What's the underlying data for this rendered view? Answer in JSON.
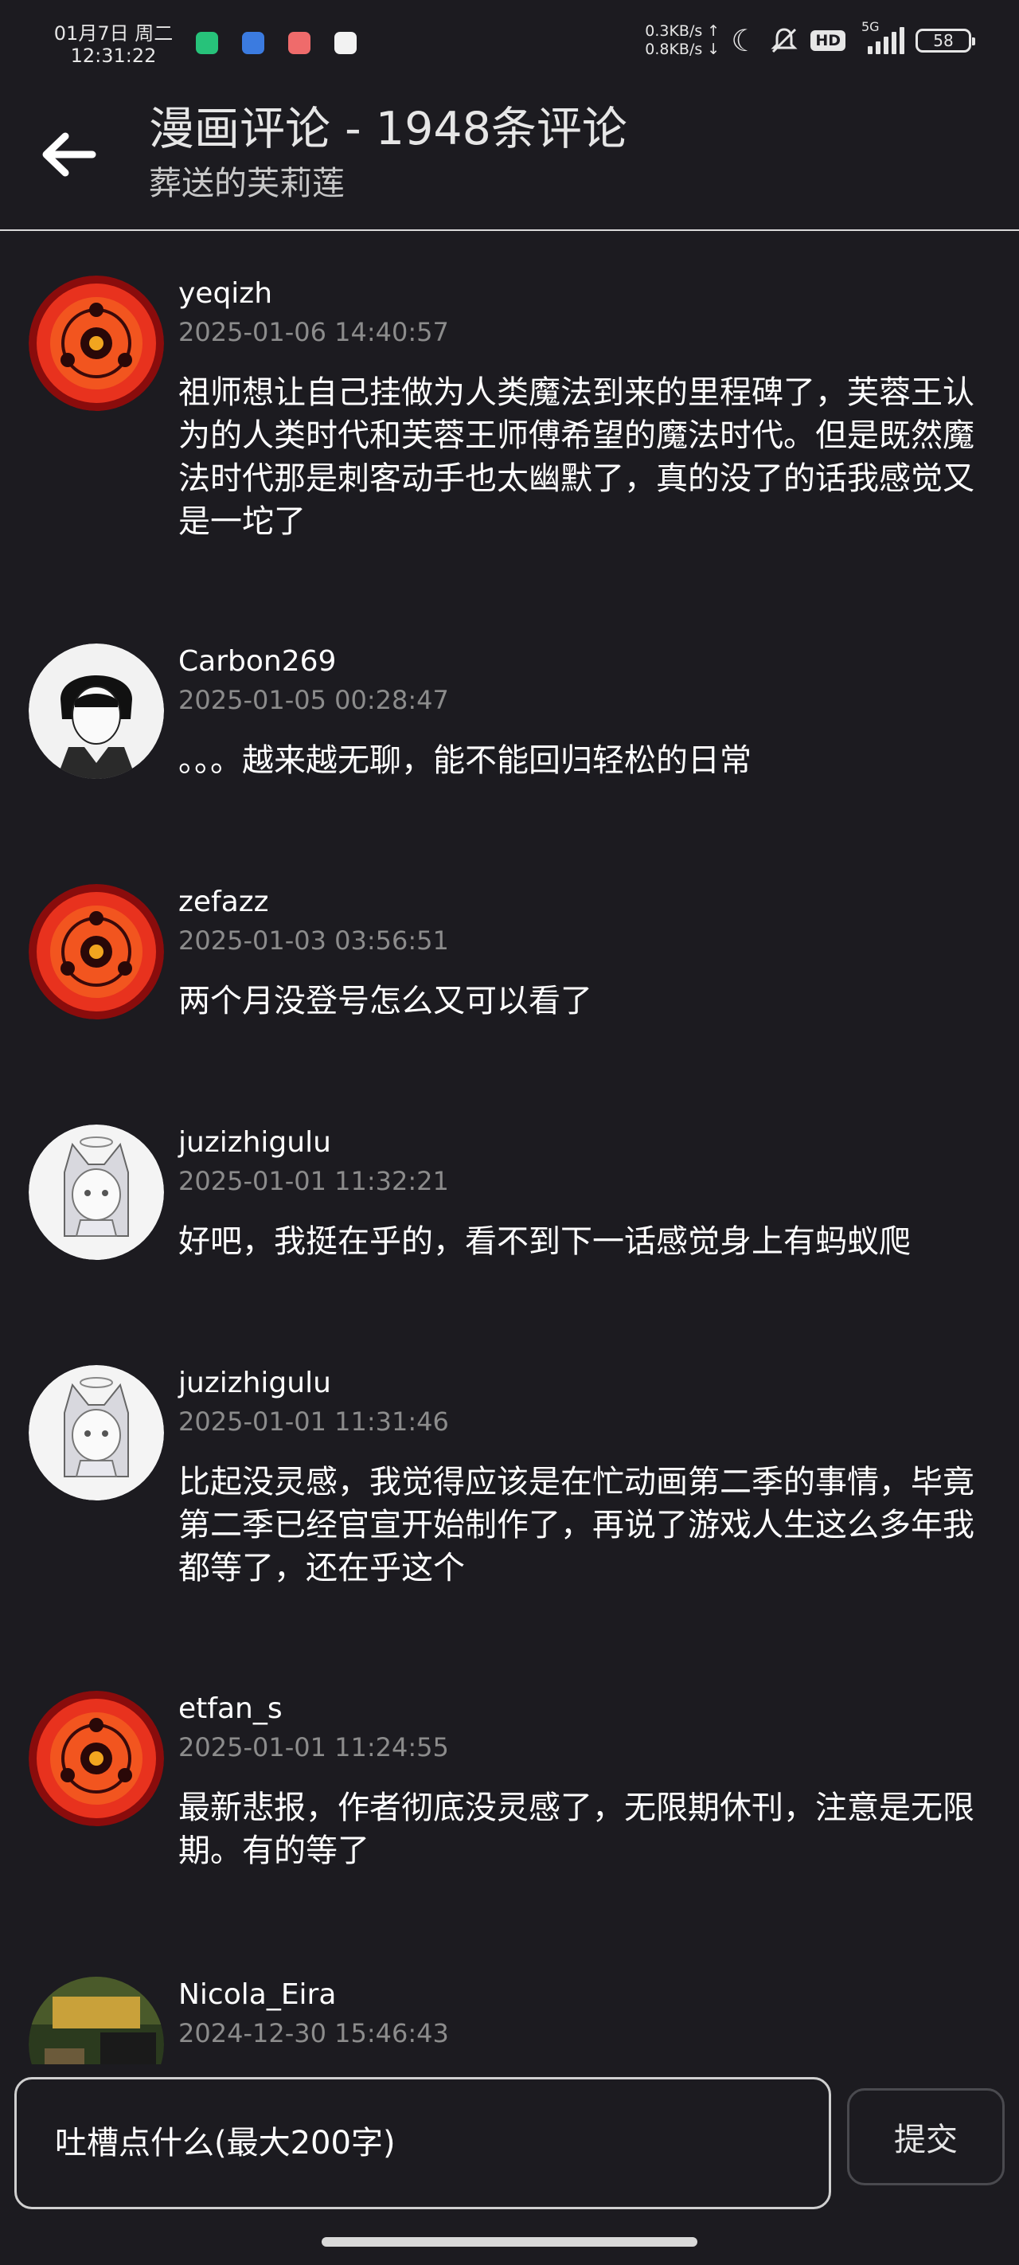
{
  "status_bar": {
    "date": "01月7日 周二",
    "time": "12:31:22",
    "up_speed": "0.3KB/s",
    "down_speed": "0.8KB/s",
    "network": "5G",
    "hd": "HD",
    "battery": "58",
    "app_icons": [
      "app-icon-green",
      "app-icon-blue",
      "app-icon-red",
      "app-icon-white"
    ]
  },
  "header": {
    "title": "漫画评论 - 1948条评论",
    "subtitle": "葬送的芙莉莲"
  },
  "comments": [
    {
      "username": "yeqizh",
      "time": "2025-01-06 14:40:57",
      "text": "祖师想让自己挂做为人类魔法到来的里程碑了，芙蓉王认为的人类时代和芙蓉王师傅希望的魔法时代。但是既然魔法时代那是刺客动手也太幽默了，真的没了的话我感觉又是一坨了",
      "avatar": "sharingan"
    },
    {
      "username": "Carbon269",
      "time": "2025-01-05 00:28:47",
      "text": "。。。越来越无聊，能不能回归轻松的日常",
      "avatar": "sketch-boy"
    },
    {
      "username": "zefazz",
      "time": "2025-01-03 03:56:51",
      "text": "两个月没登号怎么又可以看了",
      "avatar": "sharingan"
    },
    {
      "username": "juzizhigulu",
      "time": "2025-01-01 11:32:21",
      "text": "好吧，我挺在乎的，看不到下一话感觉身上有蚂蚁爬",
      "avatar": "cat-girl"
    },
    {
      "username": "juzizhigulu",
      "time": "2025-01-01 11:31:46",
      "text": "比起没灵感，我觉得应该是在忙动画第二季的事情，毕竟第二季已经官宣开始制作了，再说了游戏人生这么多年我都等了，还在乎这个",
      "avatar": "cat-girl"
    },
    {
      "username": "etfan_s",
      "time": "2025-01-01 11:24:55",
      "text": "最新悲报，作者彻底没灵感了，无限期休刊，注意是无限期。有的等了",
      "avatar": "sharingan"
    },
    {
      "username": "Nicola_Eira",
      "time": "2024-12-30 15:46:43",
      "text": "",
      "avatar": "game-screenshot"
    }
  ],
  "input": {
    "placeholder": "吐槽点什么(最大200字)"
  },
  "submit_label": "提交",
  "colors": {
    "background": "#1c1b20",
    "text_primary": "#ffffff",
    "text_secondary": "#8c8c8c",
    "divider": "#d9d9d9",
    "sharingan_red": "#e8321e"
  }
}
